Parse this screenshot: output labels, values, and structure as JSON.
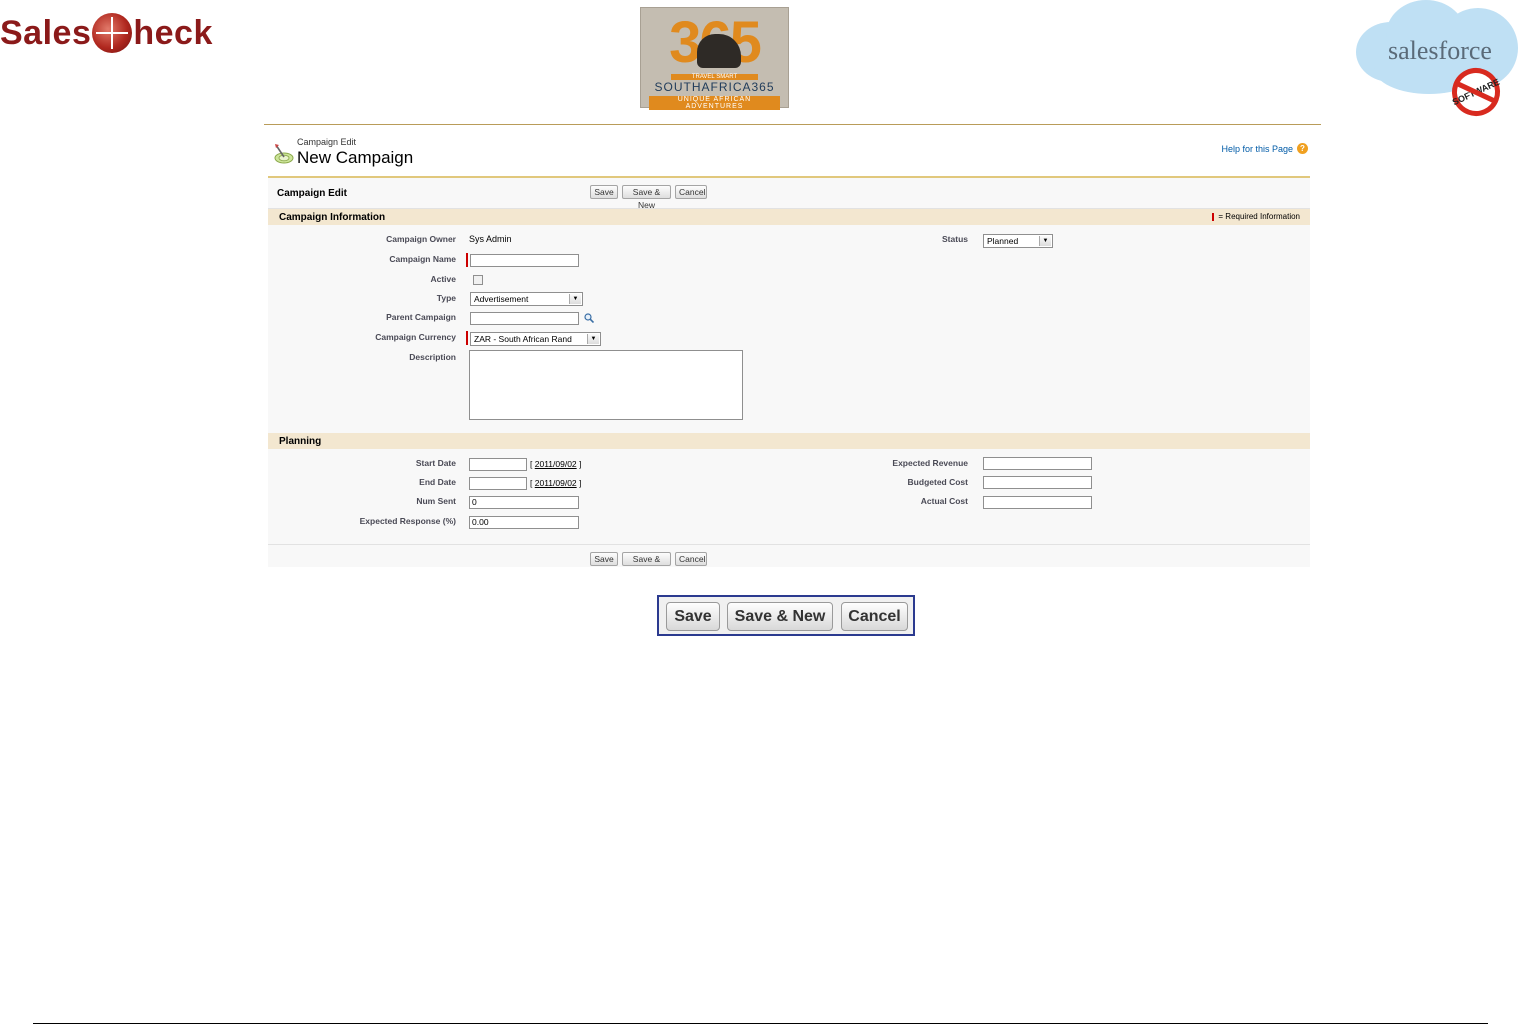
{
  "logos": {
    "salescheck_left": "Sales",
    "salescheck_right": "heck",
    "sa365_number": "365",
    "sa365_tagline_top": "TRAVEL SMART",
    "sa365_name": "SOUTHAFRICA365",
    "sa365_tagline_bottom": "UNIQUE AFRICAN ADVENTURES",
    "salesforce_word": "salesforce",
    "no_software": "SOFTWARE"
  },
  "page_header": {
    "type": "Campaign Edit",
    "title": "New Campaign",
    "help_link": "Help for this Page",
    "help_icon": "?"
  },
  "block": {
    "title": "Campaign Edit",
    "buttons": [
      "Save",
      "Save & New",
      "Cancel"
    ]
  },
  "sections": {
    "info": {
      "title": "Campaign Information",
      "required_legend": "= Required Information",
      "fields": {
        "owner_label": "Campaign Owner",
        "owner_value": "Sys Admin",
        "status_label": "Status",
        "status_value": "Planned",
        "name_label": "Campaign Name",
        "name_value": "",
        "active_label": "Active",
        "type_label": "Type",
        "type_value": "Advertisement",
        "parent_label": "Parent Campaign",
        "parent_value": "",
        "currency_label": "Campaign Currency",
        "currency_value": "ZAR - South African Rand",
        "description_label": "Description",
        "description_value": ""
      }
    },
    "planning": {
      "title": "Planning",
      "fields": {
        "start_label": "Start Date",
        "start_value": "",
        "start_link": "2011/09/02",
        "end_label": "End Date",
        "end_value": "",
        "end_link": "2011/09/02",
        "num_sent_label": "Num Sent",
        "num_sent_value": "0",
        "expected_response_label": "Expected Response (%)",
        "expected_response_value": "0.00",
        "expected_revenue_label": "Expected Revenue",
        "expected_revenue_value": "",
        "budgeted_cost_label": "Budgeted Cost",
        "budgeted_cost_value": "",
        "actual_cost_label": "Actual Cost",
        "actual_cost_value": ""
      }
    }
  },
  "footer_buttons": [
    "Save",
    "Save & New",
    "Cancel"
  ],
  "zoom_buttons": [
    "Save",
    "Save & New",
    "Cancel"
  ],
  "colors": {
    "brand_red": "#8b1a1a",
    "section_header": "#f3e7d0",
    "block_border": "#e1c87c",
    "required": "#cc0000",
    "link": "#015ba7"
  }
}
